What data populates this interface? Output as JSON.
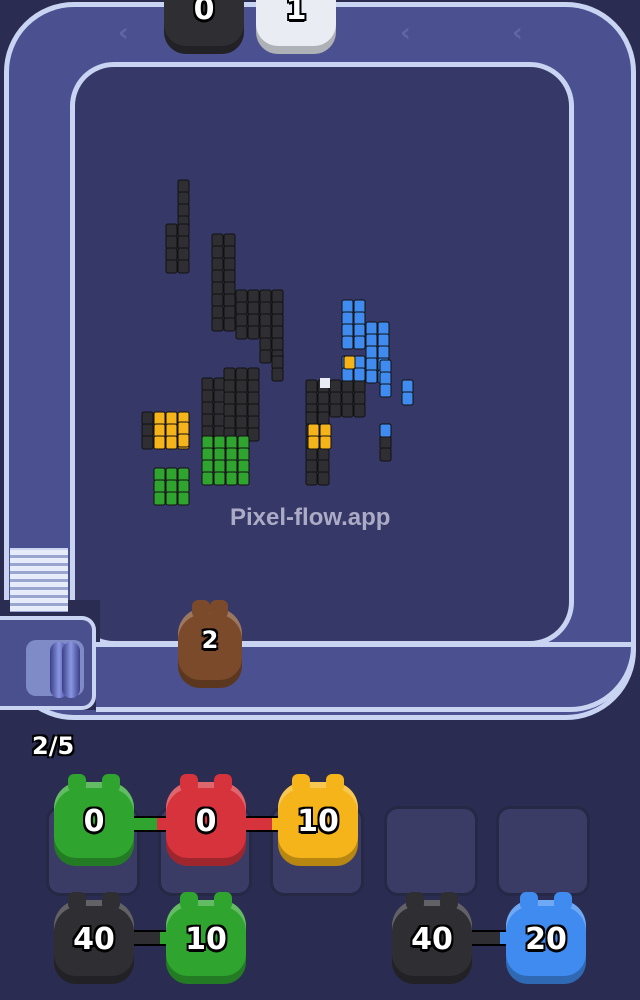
{
  "watermark": "Pixel-flow.app",
  "progress": "2/5",
  "track_pigs": [
    {
      "color": "black",
      "count": "0"
    },
    {
      "color": "white",
      "count": "1"
    }
  ],
  "active_pig": {
    "color": "brown",
    "count": "2"
  },
  "queue_row1": [
    {
      "color": "green",
      "count": "0"
    },
    {
      "color": "red",
      "count": "0"
    },
    {
      "color": "yellow",
      "count": "10"
    }
  ],
  "queue_row2_left": [
    {
      "color": "black",
      "count": "40"
    },
    {
      "color": "green",
      "count": "10"
    }
  ],
  "queue_row2_right": [
    {
      "color": "black",
      "count": "40"
    },
    {
      "color": "blue",
      "count": "20"
    }
  ],
  "empty_slots": 2,
  "colors": {
    "black": "#2e2e33",
    "green": "#2fa42f",
    "yellow": "#f5b419",
    "blue": "#3f8bef",
    "white": "#e9ecf2",
    "brown": "#7a4a2a"
  }
}
